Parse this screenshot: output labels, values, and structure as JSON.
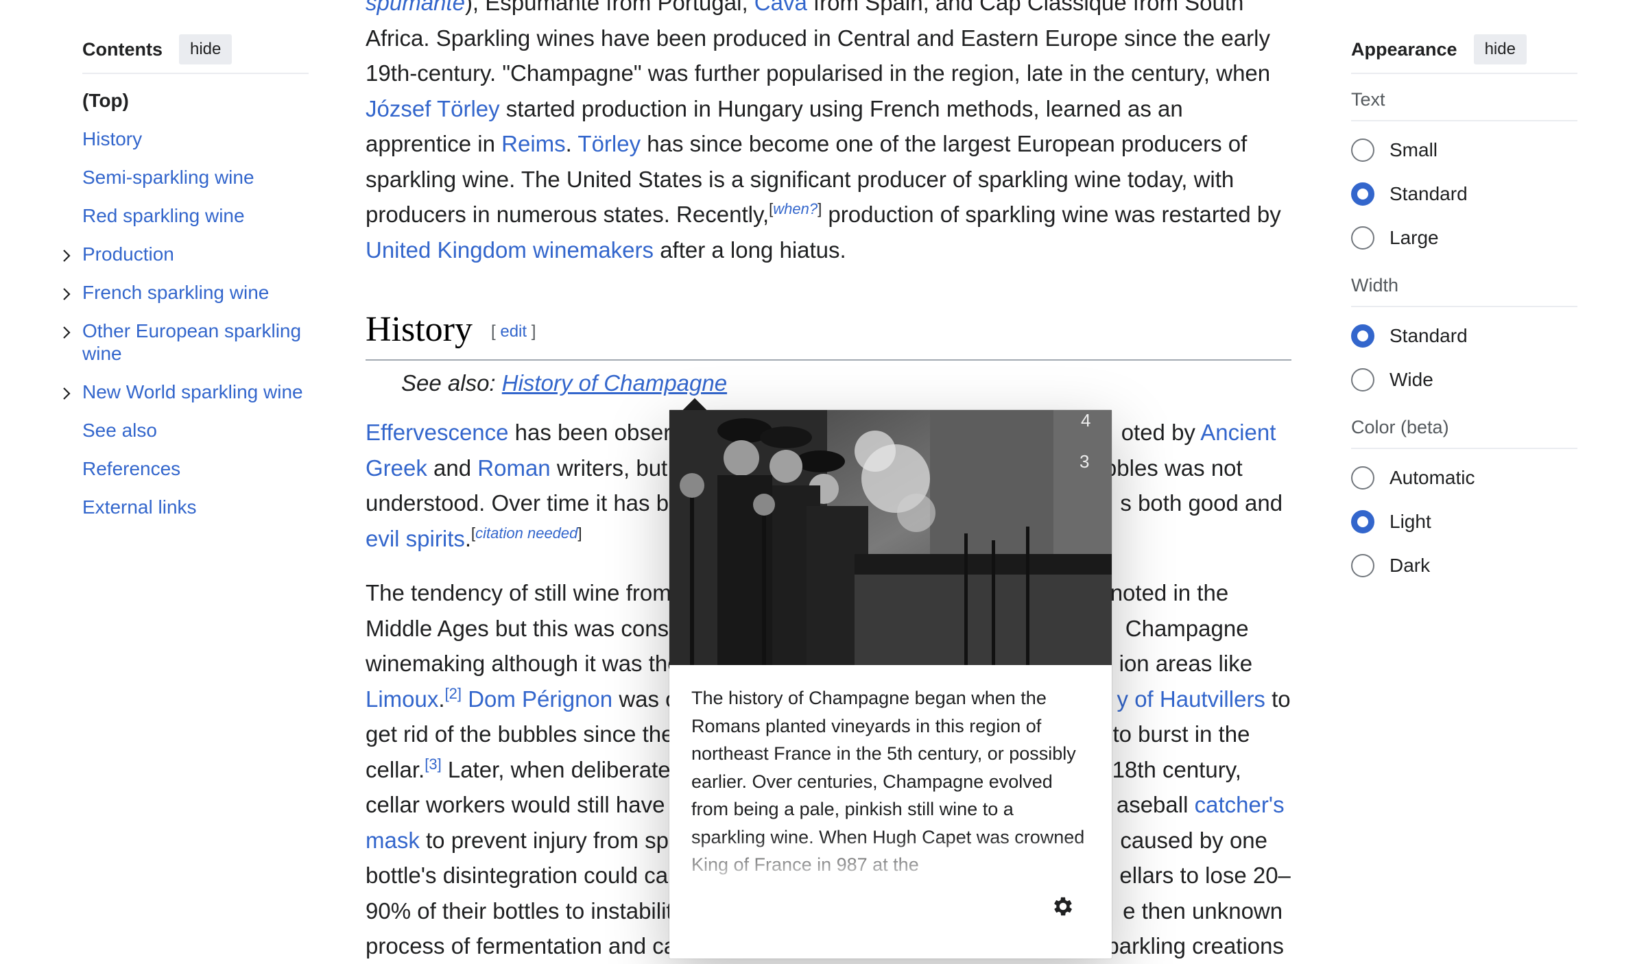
{
  "toc": {
    "title": "Contents",
    "hide_label": "hide",
    "items": [
      {
        "label": "(Top)"
      },
      {
        "label": "History"
      },
      {
        "label": "Semi-sparkling wine"
      },
      {
        "label": "Red sparkling wine"
      },
      {
        "label": "Production"
      },
      {
        "label": "French sparkling wine"
      },
      {
        "label": "Other European sparkling wine"
      },
      {
        "label": "New World sparkling wine"
      },
      {
        "label": "See also"
      },
      {
        "label": "References"
      },
      {
        "label": "External links"
      }
    ]
  },
  "article": {
    "intro": {
      "l1_link1": "spumante",
      "l1_t1": "), Espumante from Portugal, ",
      "l1_link2": "Cava",
      "l1_t2": " from Spain, and Cap Classique from South Africa.",
      "t2": "Sparkling wines have been produced in Central and Eastern Europe since the early 19th-century. \"Champagne\" was further popularised in the region, late in the century, when ",
      "link_torley_full": "József Törley",
      "t3": " started production in Hungary using French methods, learned as an apprentice in ",
      "link_reims": "Reims",
      "t4": ". ",
      "link_torley": "Törley",
      "t5": " has since become one of the largest European producers of sparkling wine. The United States is a significant producer of sparkling wine today, with producers in numerous states. Recently,",
      "sup_when": "when?",
      "t6": " production of sparkling wine was restarted by ",
      "link_uk": "United Kingdom winemakers",
      "t7": " after a long hiatus."
    },
    "history_heading": "History",
    "edit_label": "edit",
    "see_also_label": "See also: ",
    "see_also_link": "History of Champagne",
    "p1": {
      "link_eff": "Effervescence",
      "t1": " has been observ",
      "gap": " ",
      "t2": "oted by ",
      "link_ancient": "Ancient Greek",
      "t3": " and ",
      "link_roman": "Roman",
      "t4": " writers, but t",
      "t5": "ubbles was not understood. Over time it has be",
      "t6": "s both good and ",
      "link_evil": "evil spirits",
      "t7": ".",
      "sup_cite": "citation needed"
    },
    "p2": {
      "t1": "The tendency of still wine from",
      "t2": "noted in the Middle Ages but this was consid",
      "t3": "Champagne winemaking although it was the",
      "t4": "ion areas like ",
      "link_limoux": "Limoux",
      "sup2": "[2]",
      "link_dom": "Dom Pérignon",
      "t5": " was o",
      "link_abbey": "y of Hautvillers",
      "t6": " to get rid of the bubbles since the",
      "t7": "to burst in the cellar.",
      "sup3": "[3]",
      "t8": " Later, when deliberate",
      "t9": "rly 18th century, cellar workers would still have t",
      "t10": "aseball ",
      "link_mask": "catcher's mask",
      "t11": " to prevent injury from spo",
      "t12": "caused by one bottle's disintegration could cau",
      "t13": "ellars to lose 20–90% of their bottles to instability",
      "t14": "e then unknown process of fermentation and carbonic gas caused some critics to call the sparkling creations"
    }
  },
  "appearance": {
    "title": "Appearance",
    "hide_label": "hide",
    "text_label": "Text",
    "text_options": [
      "Small",
      "Standard",
      "Large"
    ],
    "text_selected": "Standard",
    "width_label": "Width",
    "width_options": [
      "Standard",
      "Wide"
    ],
    "width_selected": "Standard",
    "color_label": "Color (beta)",
    "color_options": [
      "Automatic",
      "Light",
      "Dark"
    ],
    "color_selected": "Light"
  },
  "popup": {
    "image_icon": "ship-christening-photo",
    "text": "The history of Champagne began when the Romans planted vineyards in this region of northeast France in the 5th century, or possibly earlier. Over centuries, Champagne evolved from being a pale, pinkish still wine to a sparkling wine. When Hugh Capet was crowned King of France in 987 at the",
    "settings_icon": "gear-icon"
  }
}
